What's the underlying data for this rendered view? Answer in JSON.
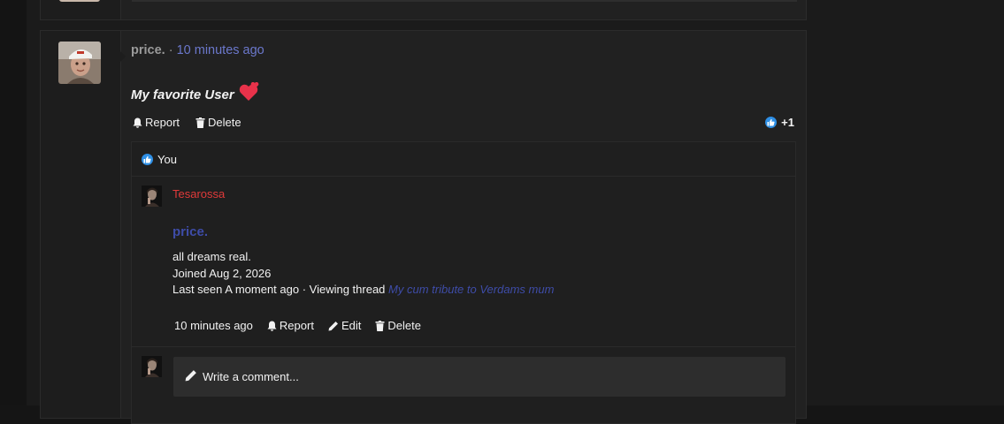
{
  "post": {
    "author": "price.",
    "separator": "·",
    "time": "10 minutes ago",
    "message": "My favorite User",
    "actions": {
      "report": "Report",
      "delete": "Delete"
    },
    "reaction_count": "+1"
  },
  "comments": {
    "likes_label": "You",
    "comment": {
      "author": "Tesarossa",
      "card": {
        "name": "price.",
        "bio": "all dreams real.",
        "joined": "Joined Aug 2, 2026",
        "last_seen": "Last seen A moment ago · Viewing thread",
        "thread_title": "My cum tribute to Verdams mum"
      },
      "time": "10 minutes ago",
      "actions": {
        "report": "Report",
        "edit": "Edit",
        "delete": "Delete"
      }
    },
    "write_placeholder": "Write a comment..."
  },
  "colors": {
    "background": "#1b1b1b",
    "panel": "#212121",
    "link_blue": "#6b78cc",
    "dark_link_blue": "#3e4ca8",
    "comment_author_red": "#e03a3a",
    "like_blue": "#2e8fe5",
    "heart_red": "#e8324a"
  },
  "icons": [
    "bell-icon",
    "trash-icon",
    "pencil-icon",
    "thumbs-up-icon",
    "heart-icon"
  ]
}
